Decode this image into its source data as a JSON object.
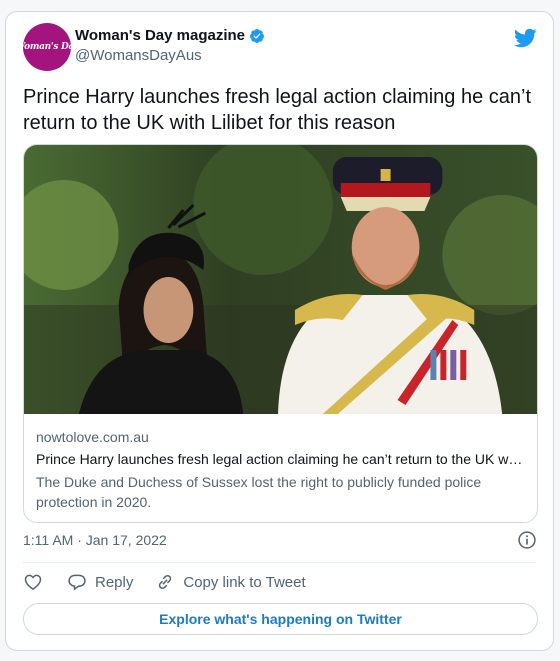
{
  "author": {
    "name": "Woman's Day magazine",
    "handle": "@WomansDayAus",
    "avatar_text": "Woman's Day",
    "avatar_color": "#a3147e",
    "verified_icon": "verified-badge-icon"
  },
  "tweet": {
    "text": "Prince Harry launches fresh legal action claiming he can’t return to the UK with Lilibet for this reason",
    "timestamp": "1:11 AM · Jan 17, 2022"
  },
  "link_card": {
    "domain": "nowtolove.com.au",
    "title": "Prince Harry launches fresh legal action claiming he can’t return to the UK with Lilibet for this reason",
    "description": "The Duke and Duchess of Sussex lost the right to publicly funded police protection in 2020."
  },
  "actions": {
    "like_icon": "heart-icon",
    "reply_label": "Reply",
    "copy_label": "Copy link to Tweet"
  },
  "footer": {
    "explore_label": "Explore what's happening on Twitter"
  },
  "colors": {
    "twitter_blue": "#1d9bf0",
    "link_blue": "#1d7bbf",
    "muted_text": "#536471"
  }
}
